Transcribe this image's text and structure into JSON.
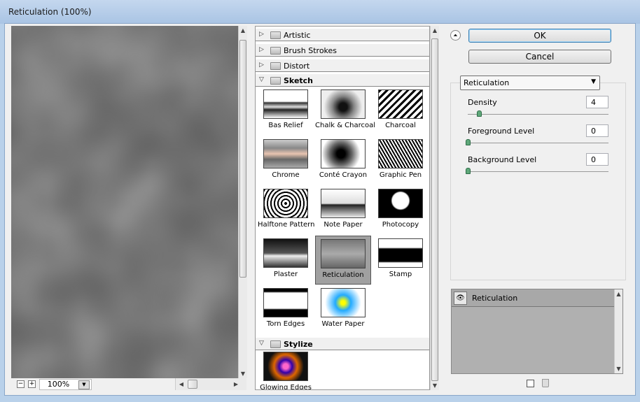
{
  "window": {
    "title": "Reticulation (100%)"
  },
  "preview": {
    "zoom": "100%",
    "zoom_out": "−",
    "zoom_in": "+"
  },
  "gallery": {
    "categories": [
      {
        "label": "Artistic",
        "expanded": false
      },
      {
        "label": "Brush Strokes",
        "expanded": false
      },
      {
        "label": "Distort",
        "expanded": false
      },
      {
        "label": "Sketch",
        "expanded": true
      },
      {
        "label": "Stylize",
        "expanded": true
      }
    ],
    "sketch_filters": [
      "Bas Relief",
      "Chalk & Charcoal",
      "Charcoal",
      "Chrome",
      "Conté Crayon",
      "Graphic Pen",
      "Halftone Pattern",
      "Note Paper",
      "Photocopy",
      "Plaster",
      "Reticulation",
      "Stamp",
      "Torn Edges",
      "Water Paper"
    ],
    "selected": "Reticulation",
    "stylize_filters": [
      "Glowing Edges"
    ]
  },
  "buttons": {
    "ok": "OK",
    "cancel": "Cancel"
  },
  "settings": {
    "filter": "Reticulation",
    "params": [
      {
        "label": "Density",
        "value": "4",
        "fraction": 0.08
      },
      {
        "label": "Foreground Level",
        "value": "0",
        "fraction": 0
      },
      {
        "label": "Background Level",
        "value": "0",
        "fraction": 0
      }
    ]
  },
  "layers": [
    {
      "label": "Reticulation",
      "visible": true
    }
  ]
}
